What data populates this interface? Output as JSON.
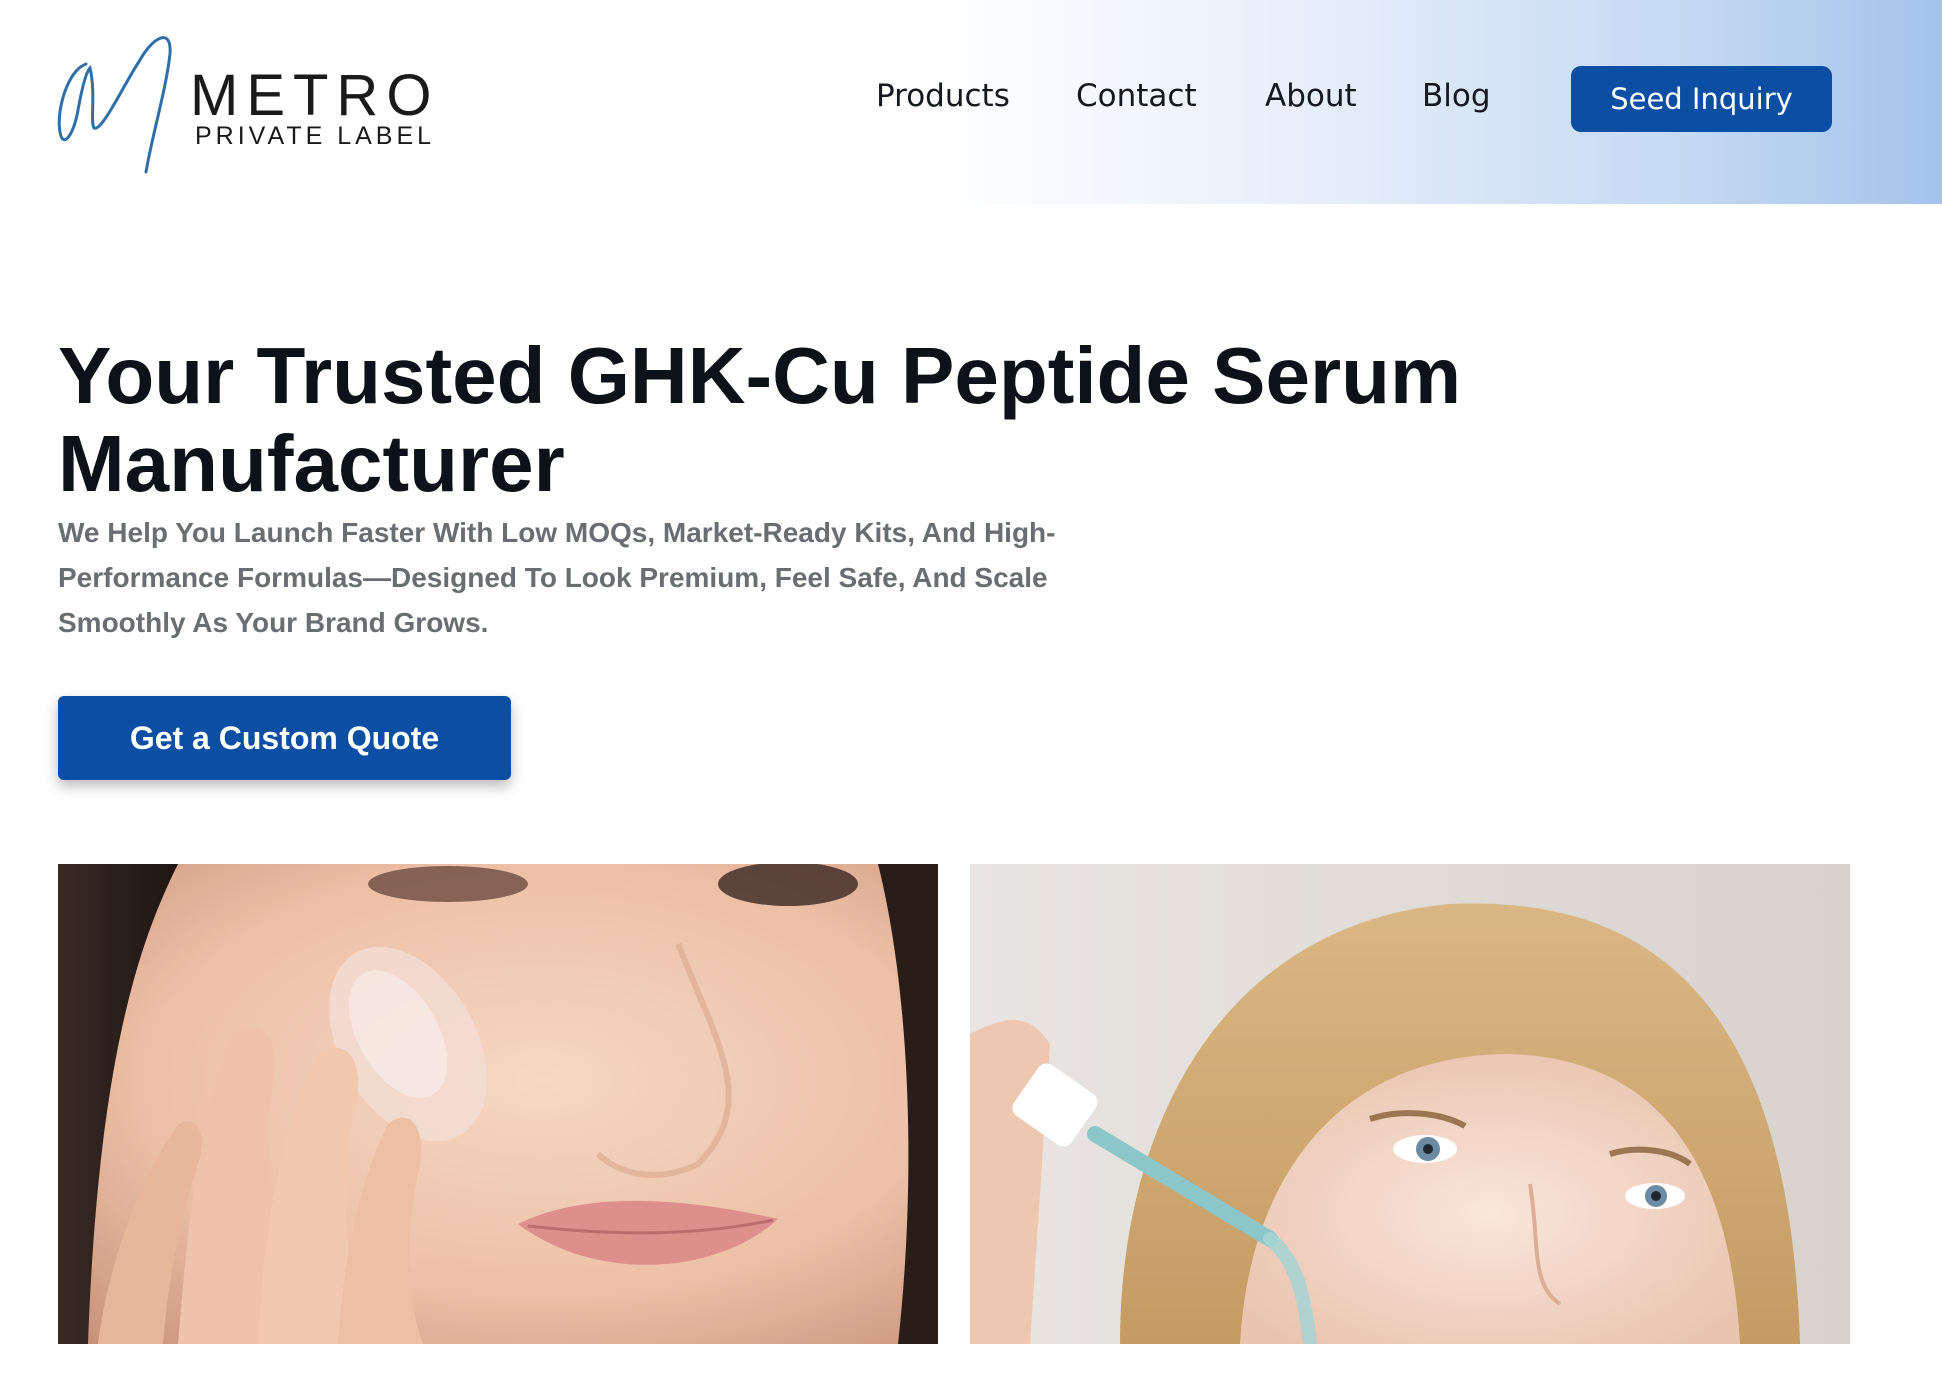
{
  "brand": {
    "name": "METRO",
    "tagline": "PRIVATE LABEL",
    "accent_color": "#0a4fa3",
    "logo_stroke_color": "#2f6fa8"
  },
  "nav": {
    "items": [
      {
        "label": "Products"
      },
      {
        "label": "Contact"
      },
      {
        "label": "About"
      },
      {
        "label": "Blog"
      }
    ],
    "cta_label": "Seed Inquiry"
  },
  "hero": {
    "title_line1": "Your Trusted GHK-Cu Peptide Serum",
    "title_line2": "Manufacturer",
    "subtitle_line1": "We Help You Launch Faster With Low MOQs, Market-Ready Kits, And High-",
    "subtitle_line2": "Performance Formulas—Designed To Look Premium, Feel Safe, And Scale",
    "subtitle_line3": "Smoothly As Your Brand Grows.",
    "cta_label": "Get a Custom Quote"
  },
  "gallery": {
    "images": [
      {
        "icon": "woman-applying-serum-photo"
      },
      {
        "icon": "woman-with-dropper-photo"
      }
    ]
  }
}
